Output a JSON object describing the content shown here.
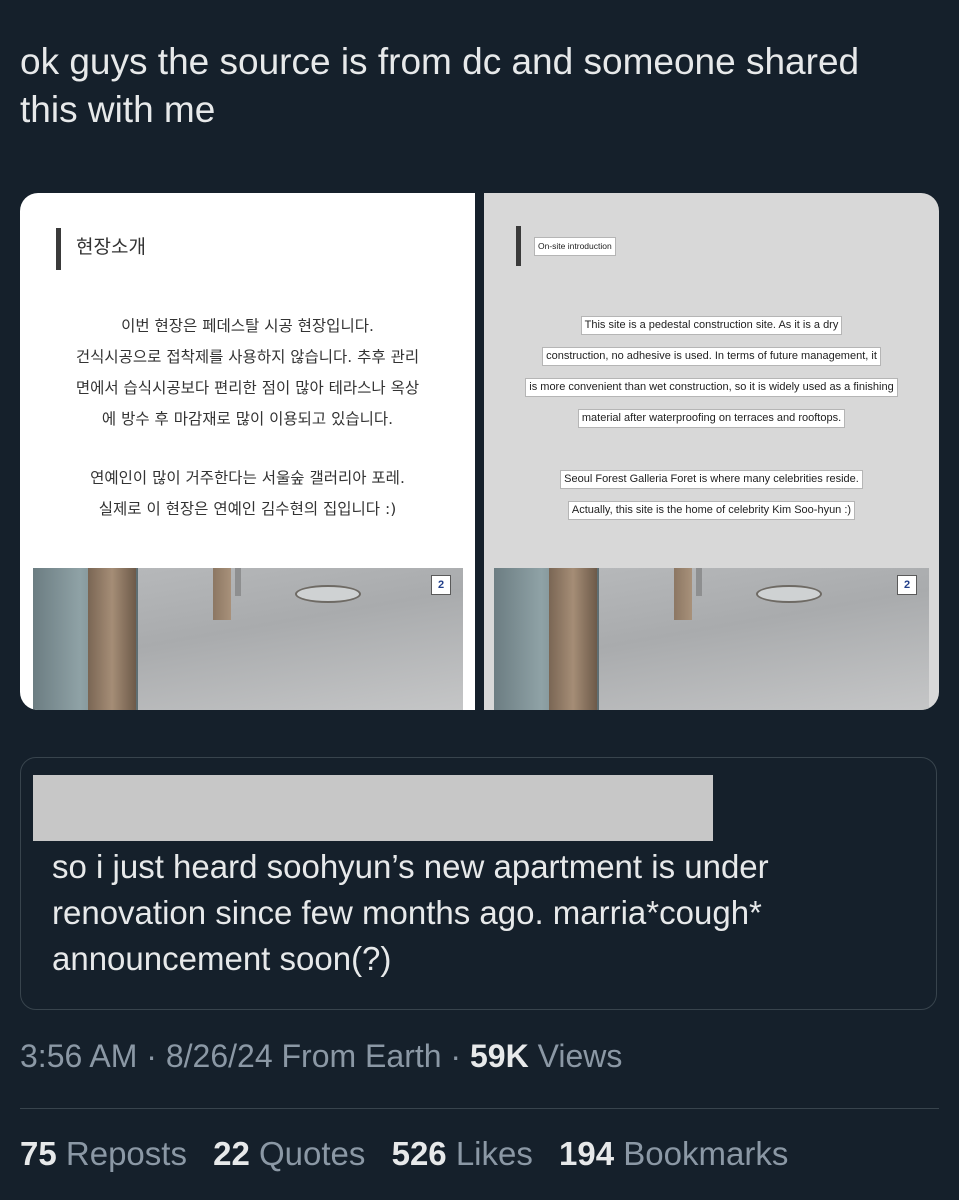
{
  "tweet": {
    "text": "ok guys the source is from dc and someone shared\nthis with me"
  },
  "media": {
    "left_image": {
      "heading": "현장소개",
      "paragraph1": [
        "이번 현장은 페데스탈 시공 현장입니다.",
        "건식시공으로 접착제를 사용하지 않습니다. 추후 관리",
        "면에서 습식시공보다 편리한 점이 많아 테라스나 옥상",
        "에 방수 후 마감재로 많이 이용되고 있습니다."
      ],
      "paragraph2": [
        "연예인이 많이 거주한다는 서울숲 갤러리아 포레.",
        "실제로 이 현장은 연예인 김수현의 집입니다 :)"
      ],
      "page_number": "2"
    },
    "right_image": {
      "heading": "On-site introduction",
      "paragraph1": [
        "This site is a pedestal construction site. As it is a dry",
        "construction, no adhesive is used. In terms of future management, it",
        "is more convenient than wet construction, so it is widely used as a finishing",
        "material after waterproofing on terraces and rooftops."
      ],
      "paragraph2": [
        "Seoul Forest Galleria Foret is where many celebrities reside.",
        "Actually, this site is the home of celebrity Kim Soo-hyun :)"
      ],
      "page_number": "2"
    }
  },
  "quote": {
    "text": "so i just heard soohyun’s new apartment is under\nrenovation since few months ago. marria*cough*\nannouncement soon(?)"
  },
  "meta": {
    "time": "3:56 AM",
    "sep1": " · ",
    "date": "8/26/24",
    "source": " From Earth",
    "sep2": " · ",
    "views_count": "59K",
    "views_label": " Views"
  },
  "stats": {
    "reposts_count": "75",
    "reposts_label": " Reposts",
    "quotes_count": "22",
    "quotes_label": " Quotes",
    "likes_count": "526",
    "likes_label": " Likes",
    "bookmarks_count": "194",
    "bookmarks_label": " Bookmarks"
  },
  "colors": {
    "background": "#15202b",
    "text": "#e7e9ea",
    "secondary_text": "#8b98a5",
    "border": "#38444d"
  }
}
